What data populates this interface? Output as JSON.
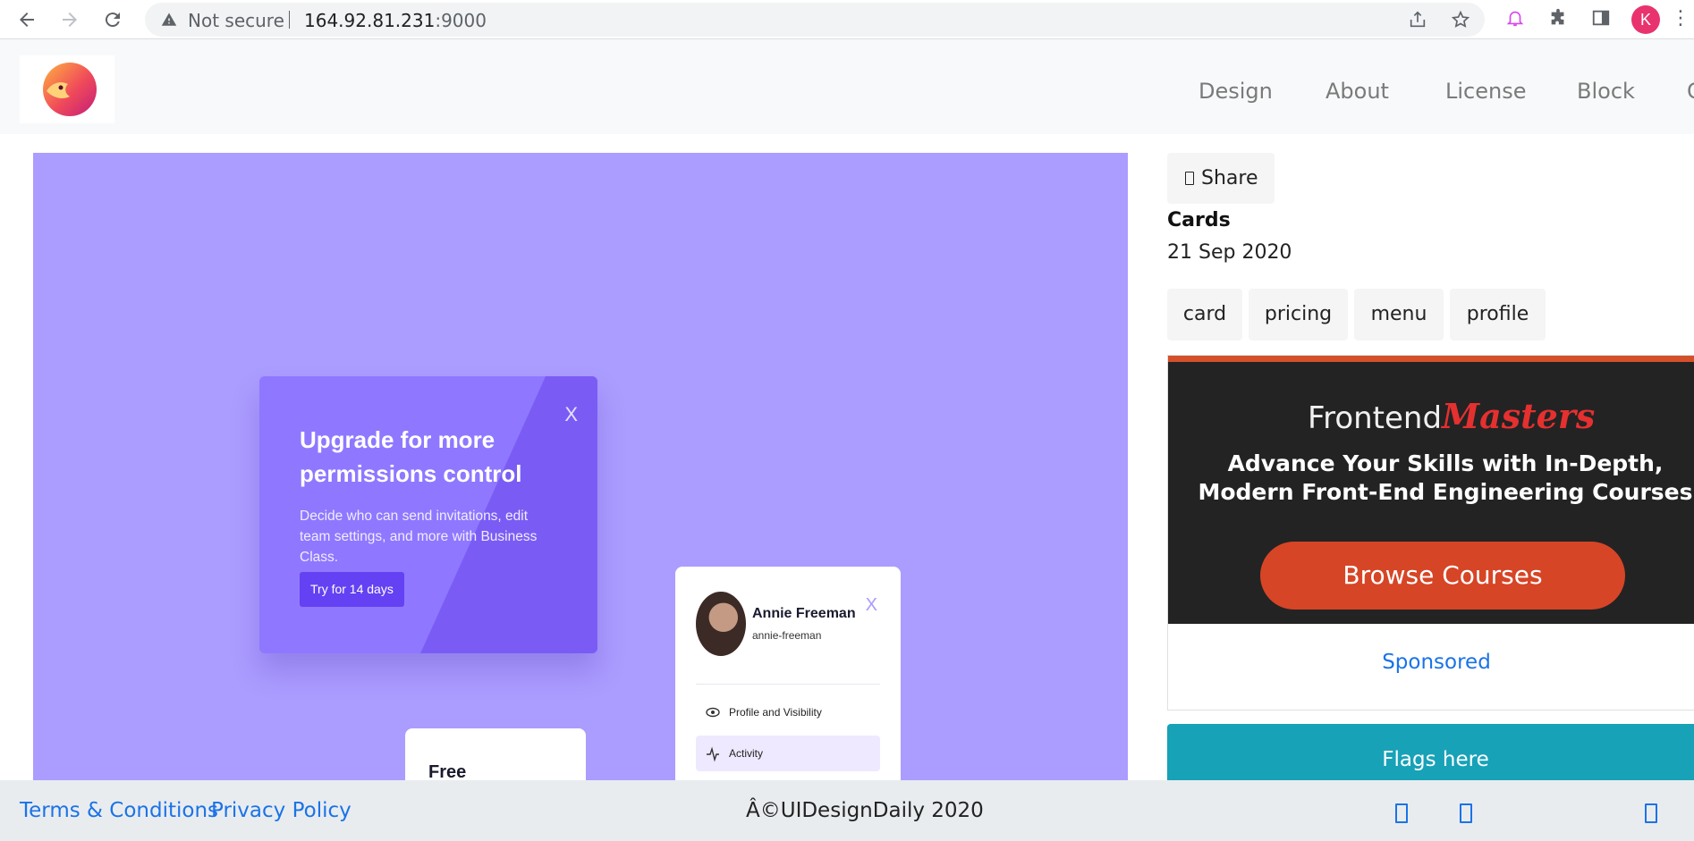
{
  "browser": {
    "security_label": "Not secure",
    "url_host": "164.92.81.231",
    "url_port": ":9000",
    "profile_initial": "K"
  },
  "site": {
    "nav": [
      "Design",
      "About",
      "License",
      "Block",
      "C"
    ]
  },
  "hero": {
    "upgrade_card": {
      "title": "Upgrade for more permissions control",
      "description": "Decide who can send invitations, edit team settings, and more with Business Class.",
      "cta": "Try for 14 days",
      "close": "X"
    },
    "profile_card": {
      "name": "Annie Freeman",
      "handle": "annie-freeman",
      "close": "X",
      "menu": [
        {
          "label": "Profile and Visibility",
          "icon": "eye-icon"
        },
        {
          "label": "Activity",
          "icon": "activity-icon",
          "active": true
        }
      ]
    },
    "pricing_card": {
      "title": "Free"
    }
  },
  "sidebar": {
    "share_label": "Share",
    "category": "Cards",
    "date": "21 Sep 2020",
    "tags": [
      "card",
      "pricing",
      "menu",
      "profile"
    ],
    "ad": {
      "brand_prefix": "Frontend",
      "brand_suffix": "Masters",
      "headline": "Advance Your Skills with In-Depth, Modern Front-End Engineering Courses",
      "cta": "Browse Courses",
      "sponsored": "Sponsored"
    },
    "flags_label": "Flags here"
  },
  "footer": {
    "terms": "Terms & Conditions",
    "privacy": "Privacy Policy",
    "copyright": "Â©UIDesignDaily 2020"
  },
  "colors": {
    "hero_bg": "#ab9cff",
    "upgrade_card": "#8f78ff",
    "cta_purple": "#6441f2",
    "ad_cta": "#d64526",
    "flags": "#17a2b8",
    "link": "#1a73e8"
  }
}
